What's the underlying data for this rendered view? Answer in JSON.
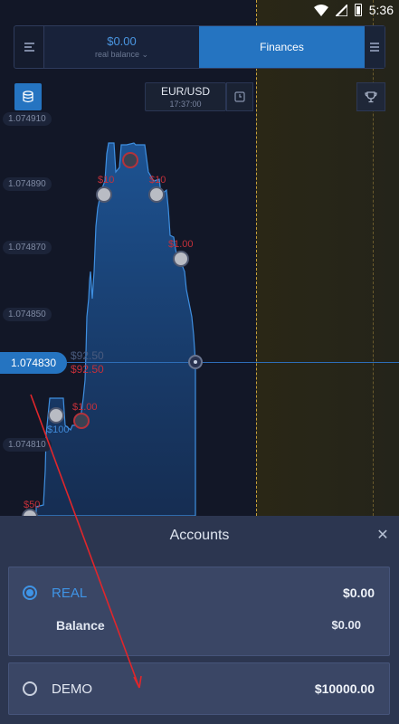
{
  "status_bar": {
    "time": "5:36"
  },
  "header": {
    "balance_amount": "$0.00",
    "balance_subtitle": "real balance ⌄",
    "finances_label": "Finances"
  },
  "toolbar": {
    "pair": "EUR/USD",
    "time": "17:37:00"
  },
  "chart": {
    "price_labels": [
      "1.074910",
      "1.074890",
      "1.074870",
      "1.074850",
      "1.074810"
    ],
    "current_price": "1.074830",
    "payout_up": "$92.50",
    "payout_down": "$92.50",
    "trades": [
      {
        "amount": "$10",
        "color": "red"
      },
      {
        "amount": "$10",
        "color": "red"
      },
      {
        "amount": "$1.00",
        "color": "red"
      },
      {
        "amount": "$1.00",
        "color": "red"
      },
      {
        "amount": "$100",
        "color": "blue"
      },
      {
        "amount": "$50",
        "color": "red"
      }
    ]
  },
  "accounts": {
    "title": "Accounts",
    "real": {
      "label": "REAL",
      "amount": "$0.00",
      "balance_label": "Balance",
      "balance_value": "$0.00"
    },
    "demo": {
      "label": "DEMO",
      "amount": "$10000.00"
    }
  },
  "colors": {
    "accent": "#2574c1",
    "down": "#c4303a",
    "sheet": "#2c3650",
    "card": "#3a4665"
  }
}
